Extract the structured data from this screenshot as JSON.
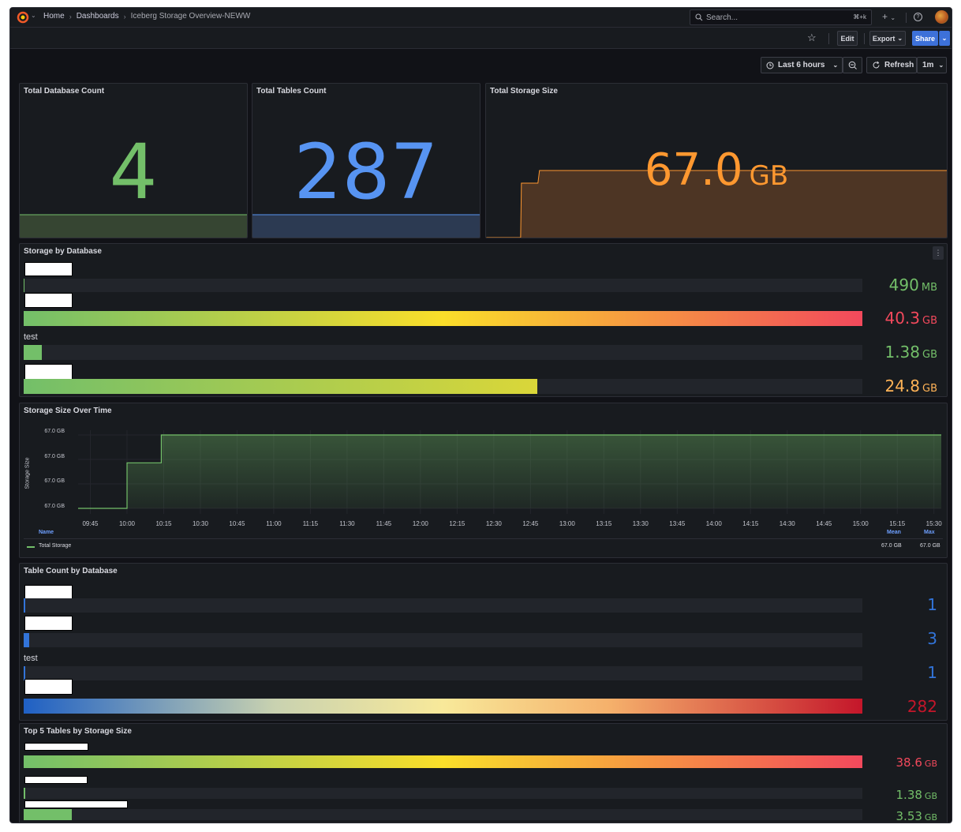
{
  "nav": {
    "breadcrumbs": [
      "Home",
      "Dashboards",
      "Iceberg Storage Overview-NEWW"
    ],
    "search_placeholder": "Search...",
    "search_shortcut": "⌘+k",
    "plus_label": "+",
    "help_label": "?"
  },
  "toolbar": {
    "edit_label": "Edit",
    "export_label": "Export",
    "share_label": "Share"
  },
  "time": {
    "range_label": "Last 6 hours",
    "refresh_label": "Refresh",
    "refresh_interval": "1m"
  },
  "colors": {
    "green": "#73bf69",
    "blue": "#5794f2",
    "orange": "#ff9830",
    "red": "#f2495c",
    "dark_red": "#c4162a"
  },
  "stats": [
    {
      "title": "Total Database Count",
      "value": "4",
      "unit": "",
      "color": "#73bf69"
    },
    {
      "title": "Total Tables Count",
      "value": "287",
      "unit": "",
      "color": "#5794f2"
    },
    {
      "title": "Total Storage Size",
      "value": "67.0",
      "unit": "GB",
      "color": "#ff9830"
    }
  ],
  "storage_by_database": {
    "title": "Storage by Database",
    "menu_icon": "kebab-menu-icon",
    "rows": [
      {
        "label": "",
        "value": "490",
        "unit": "MB",
        "fraction": 0.0012,
        "color": "#73bf69"
      },
      {
        "label": "",
        "value": "40.3",
        "unit": "GB",
        "fraction": 1.0,
        "color": "#f2495c"
      },
      {
        "label": "test",
        "value": "1.38",
        "unit": "GB",
        "fraction": 0.022,
        "color": "#73bf69"
      },
      {
        "label": "",
        "value": "24.8",
        "unit": "GB",
        "fraction": 0.612,
        "color": "#ffb357"
      }
    ]
  },
  "storage_over_time": {
    "title": "Storage Size Over Time",
    "ylabel": "Storage Size",
    "y_ticks": [
      "67.0 GB",
      "67.0 GB",
      "67.0 GB",
      "67.0 GB"
    ],
    "x_ticks": [
      "09:45",
      "10:00",
      "10:15",
      "10:30",
      "10:45",
      "11:00",
      "11:15",
      "11:30",
      "11:45",
      "12:00",
      "12:15",
      "12:30",
      "12:45",
      "13:00",
      "13:15",
      "13:30",
      "13:45",
      "14:00",
      "14:15",
      "14:30",
      "14:45",
      "15:00",
      "15:15",
      "15:30"
    ],
    "legend": {
      "name_header": "Name",
      "mean_header": "Mean",
      "max_header": "Max",
      "series_name": "Total Storage",
      "mean": "67.0 GB",
      "max": "67.0 GB"
    }
  },
  "chart_data": {
    "type": "area",
    "title": "Storage Size Over Time",
    "ylabel": "Storage Size",
    "x": [
      "09:40",
      "10:00",
      "10:00",
      "10:14",
      "10:14",
      "15:33"
    ],
    "series": [
      {
        "name": "Total Storage",
        "values": [
          0.0,
          0.0,
          0.62,
          0.62,
          1.0,
          1.0
        ]
      }
    ],
    "y_tick_labels": [
      "67.0 GB",
      "67.0 GB",
      "67.0 GB",
      "67.0 GB"
    ],
    "legend_placement": "bottom"
  },
  "table_count_by_database": {
    "title": "Table Count by Database",
    "rows": [
      {
        "label": "",
        "value": "1",
        "fraction": 0.002,
        "color": "#5794f2"
      },
      {
        "label": "",
        "value": "3",
        "fraction": 0.007,
        "color": "#5794f2"
      },
      {
        "label": "test",
        "value": "1",
        "fraction": 0.002,
        "color": "#5794f2"
      },
      {
        "label": "",
        "value": "282",
        "fraction": 1.0,
        "color": "#c4162a"
      }
    ]
  },
  "top5_tables": {
    "title": "Top 5 Tables by Storage Size",
    "rows": [
      {
        "label": "",
        "value": "38.6",
        "unit": "GB",
        "fraction": 1.0,
        "color": "#f2495c"
      },
      {
        "label": "",
        "value": "1.38",
        "unit": "GB",
        "fraction": 0.0015,
        "color": "#73bf69"
      },
      {
        "label": "",
        "value": "3.53",
        "unit": "GB",
        "fraction": 0.057,
        "color": "#73bf69"
      }
    ]
  }
}
